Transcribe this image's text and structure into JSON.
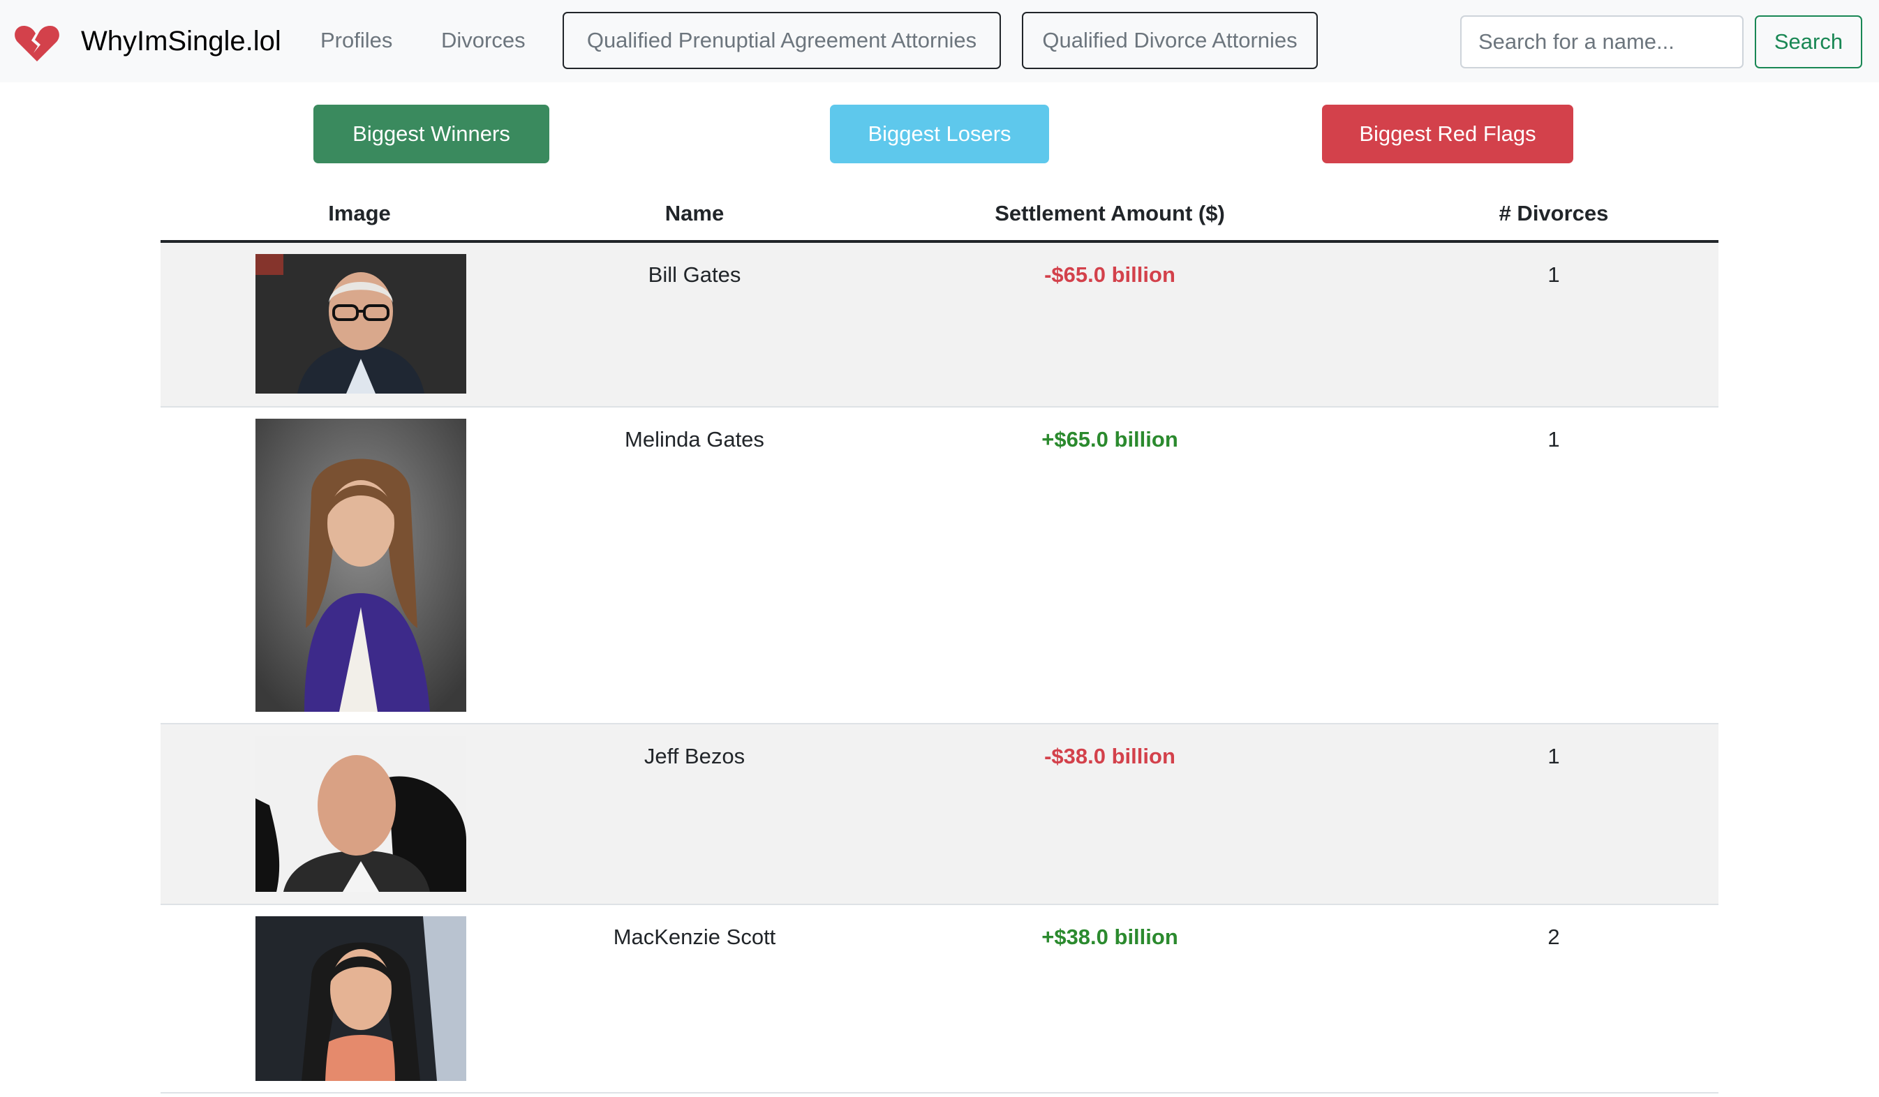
{
  "navbar": {
    "brand_icon": "broken-heart-icon",
    "brand_text": "WhyImSingle.lol",
    "links": {
      "profiles": "Profiles",
      "divorces": "Divorces"
    },
    "prenup_attorneys_label": "Qualified Prenuptial Agreement Attornies",
    "divorce_attorneys_label": "Qualified Divorce Attornies",
    "search": {
      "placeholder": "Search for a name...",
      "value": "",
      "button_label": "Search"
    }
  },
  "filters": {
    "winners_label": "Biggest Winners",
    "losers_label": "Biggest Losers",
    "red_flags_label": "Biggest Red Flags"
  },
  "colors": {
    "winners": "#3a8a5e",
    "losers": "#5ec8ec",
    "red_flags": "#d3414b",
    "negative_amount": "#d3414b",
    "positive_amount": "#2b8a2e",
    "search_accent": "#198754"
  },
  "table": {
    "headers": {
      "image": "Image",
      "name": "Name",
      "amount": "Settlement Amount ($)",
      "divorces": "# Divorces"
    },
    "rows": [
      {
        "name": "Bill Gates",
        "amount": "-$65.0 billion",
        "divorces": "1"
      },
      {
        "name": "Melinda Gates",
        "amount": "+$65.0 billion",
        "divorces": "1"
      },
      {
        "name": "Jeff Bezos",
        "amount": "-$38.0 billion",
        "divorces": "1"
      },
      {
        "name": "MacKenzie Scott",
        "amount": "+$38.0 billion",
        "divorces": "2"
      }
    ]
  }
}
